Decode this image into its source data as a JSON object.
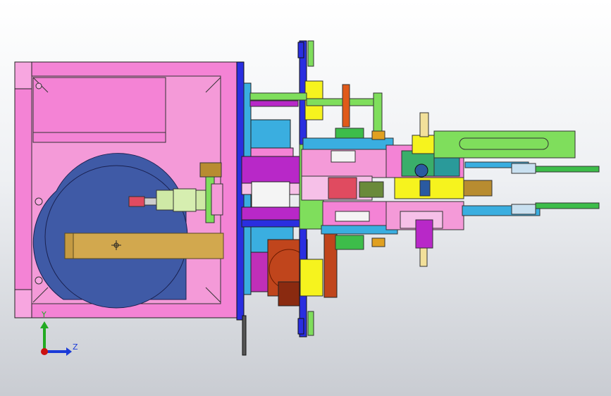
{
  "viewport": {
    "kind": "3D CAD assembly view"
  },
  "triad": {
    "y_label": "Y",
    "z_label": "Z",
    "y_color": "#22aa22",
    "z_color": "#1a3ad8",
    "origin_color": "#cc1111"
  },
  "colors": {
    "housing": "#f483d5",
    "disc": "#3f5aa6",
    "arm": "#d2a84e",
    "plate": "#2a2ee0",
    "green": "#7fde5c",
    "yellow": "#f6f31e",
    "cyan": "#3aaee0",
    "magenta": "#b828c8",
    "orange": "#c0451c"
  }
}
